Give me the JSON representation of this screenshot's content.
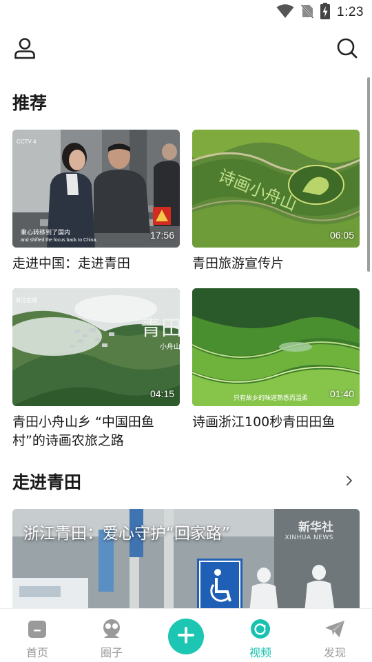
{
  "status_bar": {
    "time": "1:23",
    "icons": [
      "wifi-icon",
      "no-sim-icon",
      "battery-charging-icon"
    ]
  },
  "app_bar": {
    "left_icon": "user-icon",
    "right_icon": "search-icon"
  },
  "recommend": {
    "title": "推荐",
    "items": [
      {
        "title": "走进中国：走进青田",
        "duration": "17:56",
        "caption": "重心转移到了国内",
        "caption_en": "and shifted the focus back to China.",
        "logo": "CCTV 4"
      },
      {
        "title": "青田旅游宣传片",
        "duration": "06:05",
        "field_text": "诗画小舟山"
      },
      {
        "title": "青田小舟山乡 “中国田鱼村”的诗画农旅之路",
        "duration": "04:15",
        "calligraphy": "青田",
        "sub": "小舟山乡",
        "corner_tag": "浙江在线"
      },
      {
        "title": "诗画浙江100秒青田田鱼",
        "duration": "01:40",
        "caption": "只有故乡的味道熟悉而温柔"
      }
    ]
  },
  "walk_in": {
    "title": "走进青田",
    "more_icon": "chevron-right-icon",
    "video_title": "浙江青田：爱心守护“回家路”",
    "watermark": "新华社",
    "watermark_en": "XINHUA NEWS"
  },
  "bottom_nav": {
    "items": [
      {
        "label": "首页",
        "icon": "home-icon",
        "active": false
      },
      {
        "label": "圈子",
        "icon": "circle-community-icon",
        "active": false
      },
      {
        "label": "",
        "icon": "add-icon",
        "active": false
      },
      {
        "label": "视频",
        "icon": "video-refresh-icon",
        "active": true
      },
      {
        "label": "发现",
        "icon": "paper-plane-icon",
        "active": false
      }
    ]
  },
  "colors": {
    "accent": "#18c2b0",
    "nav_inactive": "#9a9a9a",
    "text": "#1a1a1a"
  }
}
